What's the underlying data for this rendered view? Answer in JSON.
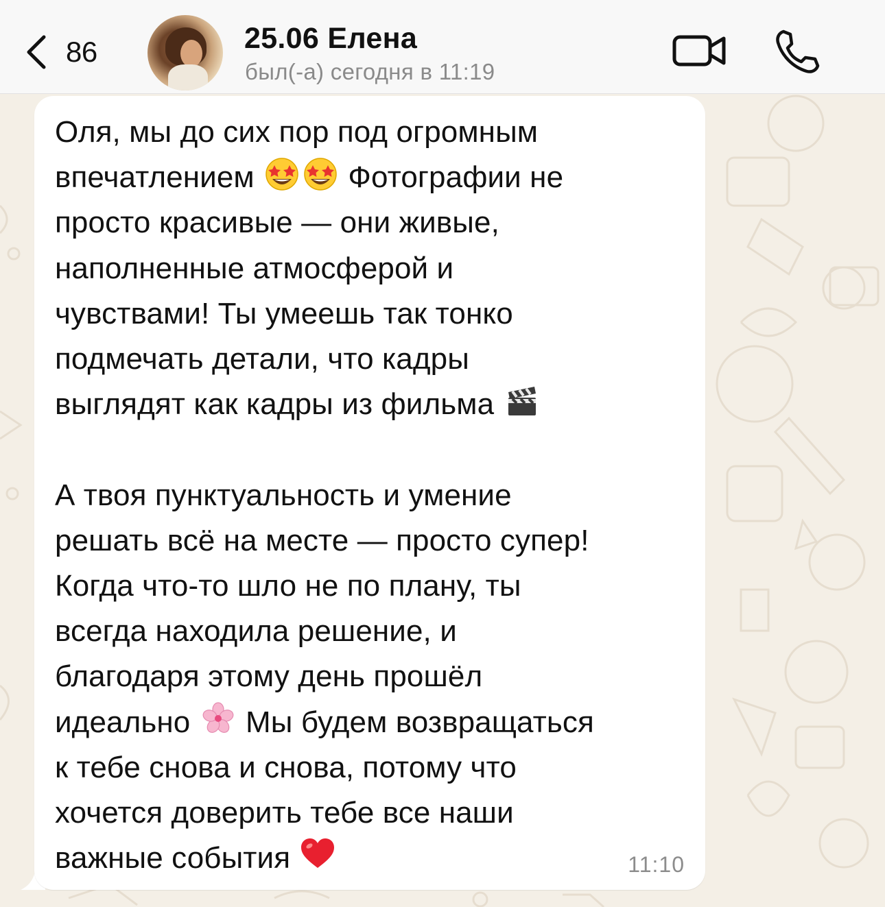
{
  "header": {
    "back_count": "86",
    "contact_name": "25.06 Елена",
    "status": "был(-а) сегодня в 11:19"
  },
  "icons": {
    "back": "chevron-left-icon",
    "video_call": "video-camera-icon",
    "voice_call": "phone-icon",
    "avatar": "contact-avatar"
  },
  "message": {
    "paragraph_1": {
      "line_1": "Оля, мы до сих пор под огромным",
      "line_2_before": "впечатлением ",
      "line_2_after": " Фотографии не",
      "line_3": "просто красивые — они живые,",
      "line_4": "наполненные атмосферой и",
      "line_5": "чувствами! Ты умеешь так тонко",
      "line_6": "подмечать детали, что кадры",
      "line_7_before": "выглядят как кадры из фильма "
    },
    "paragraph_2": {
      "line_1": "А твоя пунктуальность и умение",
      "line_2": "решать всё на месте — просто супер!",
      "line_3": "Когда что-то шло не по плану, ты",
      "line_4": "всегда находила решение, и",
      "line_5": "благодаря этому день прошёл",
      "line_6_before": "идеально ",
      "line_6_after": " Мы будем возвращаться",
      "line_7": "к тебе снова и снова, потому что",
      "line_8": "хочется доверить тебе все наши",
      "line_9_before": "важные события "
    },
    "emojis": [
      "star-struck-emoji",
      "star-struck-emoji",
      "clapper-board-emoji",
      "cherry-blossom-emoji",
      "red-heart-emoji"
    ],
    "time": "11:10"
  },
  "colors": {
    "chat_background": "#f4efe6",
    "bubble": "#ffffff",
    "header": "#f8f8f8",
    "text": "#111111",
    "muted": "#8a8a8a"
  }
}
